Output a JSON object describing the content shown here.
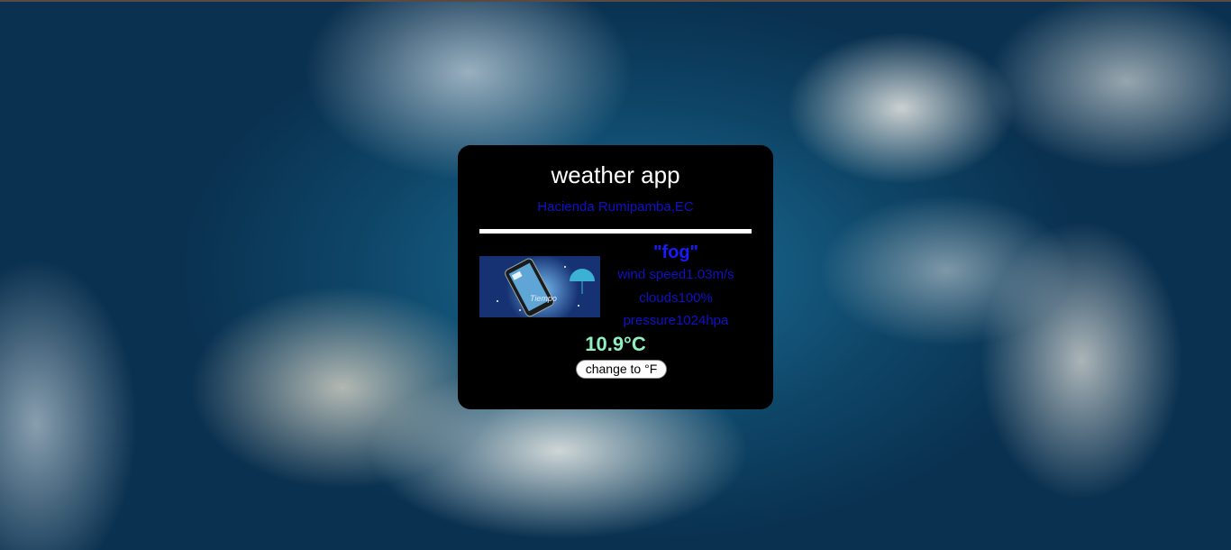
{
  "app": {
    "title": "weather app",
    "location": "Hacienda Rumipamba,EC"
  },
  "weather": {
    "description": "\"fog\"",
    "wind_speed": "wind speed1.03m/s",
    "clouds": "clouds100%",
    "pressure": "pressure1024hpa",
    "temperature": "10.9°C",
    "icon_caption": "Tiempo"
  },
  "controls": {
    "toggle_unit_label": "change to °F"
  },
  "colors": {
    "card_background": "#000000",
    "location_text": "#1010c8",
    "description_text": "#1a1aff",
    "temperature_text": "#8ff0c0",
    "divider": "#ffffff"
  },
  "icons": {
    "weather_image": "weather-phone-umbrella-icon"
  }
}
